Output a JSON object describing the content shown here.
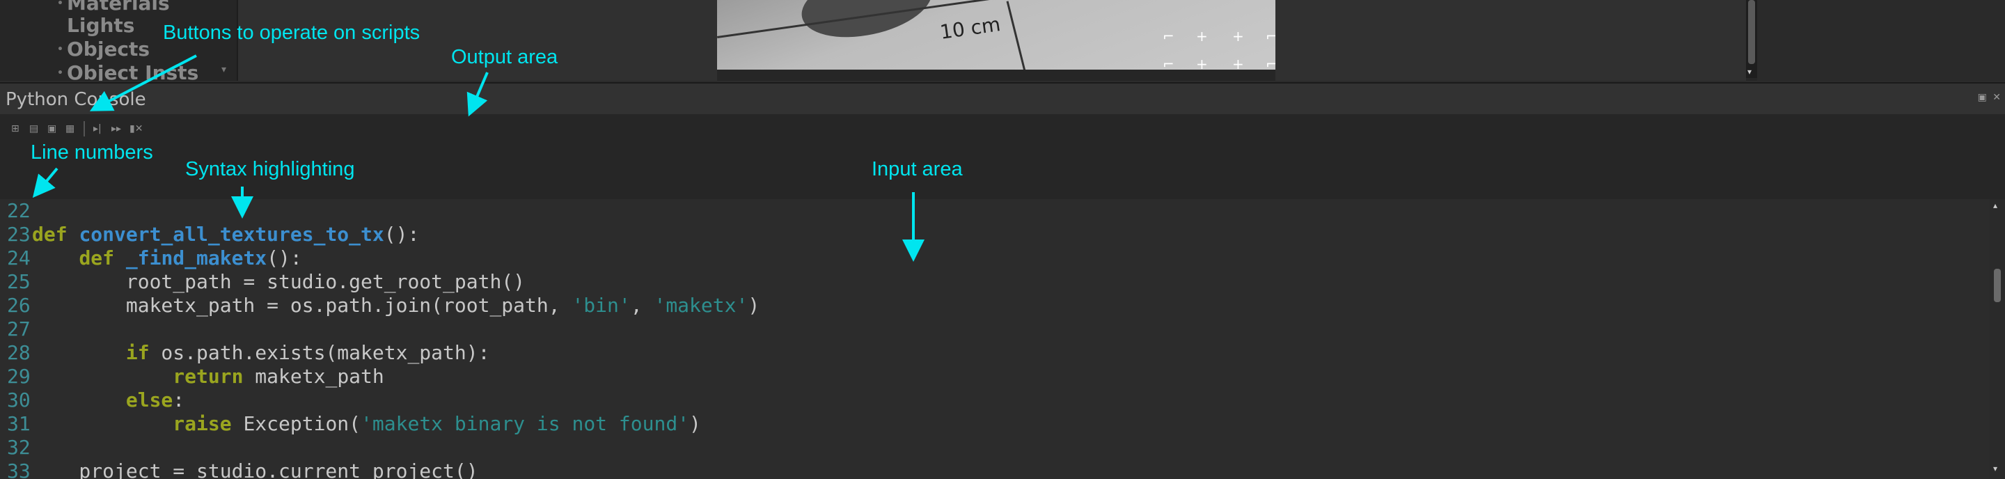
{
  "tree": {
    "items": [
      "Materials",
      "Lights",
      "Objects",
      "Object Insts"
    ]
  },
  "viewport": {
    "scale_label": "10 cm"
  },
  "console": {
    "title": "Python Console",
    "panel_buttons": "▣ ✕"
  },
  "toolbar": {
    "buttons": [
      {
        "name": "new-script",
        "glyph": "⊞"
      },
      {
        "name": "open-script",
        "glyph": "▤"
      },
      {
        "name": "save-script",
        "glyph": "▣"
      },
      {
        "name": "save-as",
        "glyph": "▦"
      },
      {
        "name": "run-line",
        "glyph": "▸|"
      },
      {
        "name": "run-all",
        "glyph": "▸▸"
      },
      {
        "name": "clear",
        "glyph": "▮✕"
      }
    ]
  },
  "code": {
    "lines": [
      {
        "num": "22",
        "tokens": []
      },
      {
        "num": "23",
        "tokens": [
          {
            "t": "def",
            "c": "kw"
          },
          {
            "t": " "
          },
          {
            "t": "convert_all_textures_to_tx",
            "c": "fn"
          },
          {
            "t": "():"
          }
        ]
      },
      {
        "num": "24",
        "tokens": [
          {
            "t": "    "
          },
          {
            "t": "def",
            "c": "kw"
          },
          {
            "t": " "
          },
          {
            "t": "_find_maketx",
            "c": "fn"
          },
          {
            "t": "():"
          }
        ]
      },
      {
        "num": "25",
        "tokens": [
          {
            "t": "        root_path = studio.get_root_path()"
          }
        ]
      },
      {
        "num": "26",
        "tokens": [
          {
            "t": "        maketx_path = os.path.join(root_path, "
          },
          {
            "t": "'bin'",
            "c": "st"
          },
          {
            "t": ", "
          },
          {
            "t": "'maketx'",
            "c": "st"
          },
          {
            "t": ")"
          }
        ]
      },
      {
        "num": "27",
        "tokens": []
      },
      {
        "num": "28",
        "tokens": [
          {
            "t": "        "
          },
          {
            "t": "if",
            "c": "kw"
          },
          {
            "t": " os.path.exists(maketx_path):"
          }
        ]
      },
      {
        "num": "29",
        "tokens": [
          {
            "t": "            "
          },
          {
            "t": "return",
            "c": "kw"
          },
          {
            "t": " maketx_path"
          }
        ]
      },
      {
        "num": "30",
        "tokens": [
          {
            "t": "        "
          },
          {
            "t": "else",
            "c": "kw"
          },
          {
            "t": ":"
          }
        ]
      },
      {
        "num": "31",
        "tokens": [
          {
            "t": "            "
          },
          {
            "t": "raise",
            "c": "kw"
          },
          {
            "t": " Exception("
          },
          {
            "t": "'maketx binary is not found'",
            "c": "st"
          },
          {
            "t": ")"
          }
        ]
      },
      {
        "num": "32",
        "tokens": []
      },
      {
        "num": "33",
        "tokens": [
          {
            "t": "    project = studio.current_project()"
          }
        ]
      }
    ]
  },
  "annotations": {
    "buttons": "Buttons to operate on scripts",
    "output": "Output area",
    "line_numbers": "Line numbers",
    "syntax": "Syntax highlighting",
    "input": "Input area"
  },
  "colors": {
    "annotation": "#00e5ef",
    "keyword": "#9aa51f",
    "function": "#3c8fd0",
    "string": "#2d8f8f",
    "line_number": "#3d8e96"
  }
}
